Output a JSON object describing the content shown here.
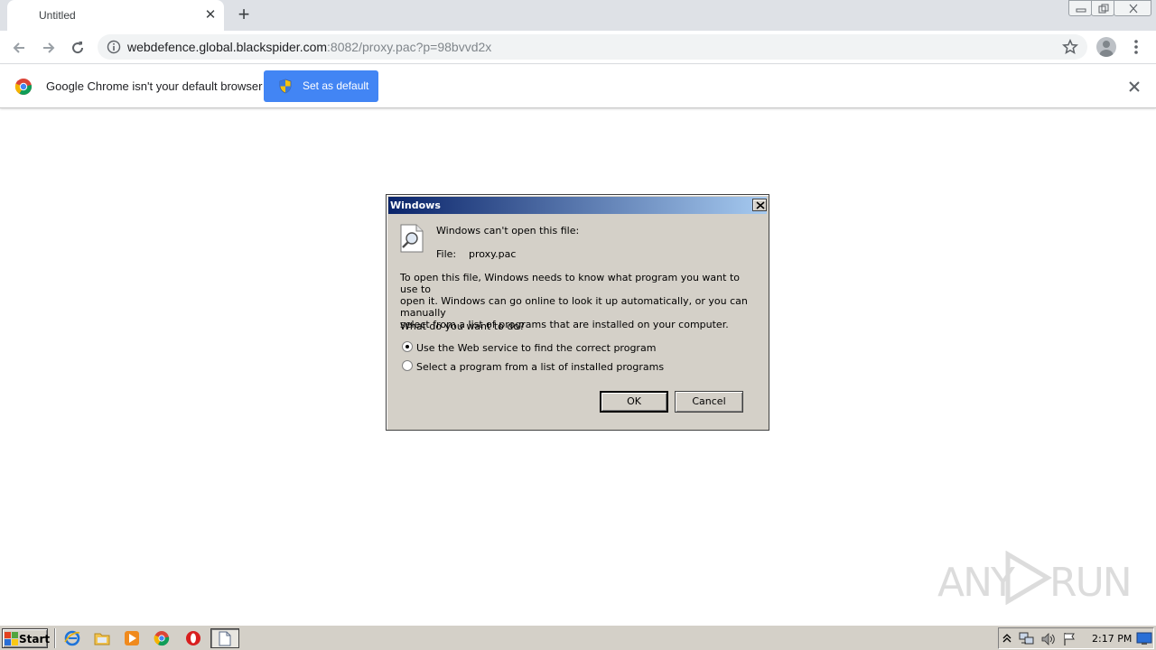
{
  "browser": {
    "tab": {
      "title": "Untitled"
    },
    "address": {
      "host": "webdefence.global.blackspider.com",
      "path": ":8082/proxy.pac?p=98bvvd2x"
    }
  },
  "infobar": {
    "message": "Google Chrome isn't your default browser",
    "button_label": "Set as default"
  },
  "dialog": {
    "title": "Windows",
    "heading": "Windows can't open this file:",
    "file_label": "File:",
    "file_name": "proxy.pac",
    "description_lines": [
      "To open this file, Windows needs to know what program you want to use to",
      "open it. Windows can go online to look it up automatically, or you can manually",
      "select from a list of programs that are installed on your computer."
    ],
    "question": "What do you want to do?",
    "options": [
      {
        "label": "Use the Web service to find the correct program",
        "selected": true
      },
      {
        "label": "Select a program from a list of installed programs",
        "selected": false
      }
    ],
    "ok_label": "OK",
    "cancel_label": "Cancel"
  },
  "watermark": {
    "left": "ANY",
    "right": "RUN"
  },
  "taskbar": {
    "start_label": "Start",
    "clock": "2:17 PM"
  },
  "colors": {
    "chrome_tabstrip": "#dee1e6",
    "infobar_button": "#4285f4",
    "dialog_face": "#d4d0c8",
    "titlebar_start": "#0a246a",
    "titlebar_end": "#a6caf0"
  },
  "icons": {
    "tab_close": "close-icon",
    "new_tab": "plus-icon",
    "back": "arrow-left-icon",
    "forward": "arrow-right-icon",
    "reload": "reload-icon",
    "site_info": "info-icon",
    "bookmark": "star-icon",
    "profile": "avatar-icon",
    "menu": "more-vert-icon",
    "chrome": "chrome-logo-icon",
    "shield": "uac-shield-icon",
    "dialog_file": "file-search-icon"
  }
}
